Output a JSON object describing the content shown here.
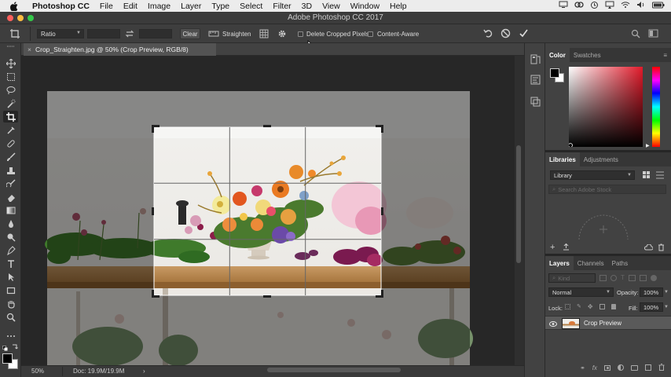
{
  "menubar": {
    "app_name": "Photoshop CC",
    "items": [
      "File",
      "Edit",
      "Image",
      "Layer",
      "Type",
      "Select",
      "Filter",
      "3D",
      "View",
      "Window",
      "Help"
    ]
  },
  "window": {
    "title": "Adobe Photoshop CC 2017"
  },
  "options_bar": {
    "ratio_label": "Ratio",
    "clear_label": "Clear",
    "straighten_label": "Straighten",
    "delete_cropped_label": "Delete Cropped Pixels",
    "delete_cropped_checked": false,
    "content_aware_label": "Content-Aware",
    "content_aware_checked": false
  },
  "document": {
    "tab_title": "Crop_Straighten.jpg @ 50% (Crop Preview, RGB/8)"
  },
  "status": {
    "zoom": "50%",
    "doc_info": "Doc: 19.9M/19.9M"
  },
  "color_panel": {
    "tabs": [
      "Color",
      "Swatches"
    ],
    "active_tab": "Color",
    "foreground": "#000000",
    "background": "#ffffff",
    "hue": "#e21a2a"
  },
  "libraries_panel": {
    "tabs": [
      "Libraries",
      "Adjustments"
    ],
    "active_tab": "Libraries",
    "library_select": "Library",
    "search_placeholder": "Search Adobe Stock"
  },
  "layers_panel": {
    "tabs": [
      "Layers",
      "Channels",
      "Paths"
    ],
    "active_tab": "Layers",
    "kind_placeholder": "Kind",
    "blend_mode": "Normal",
    "opacity_label": "Opacity:",
    "opacity_value": "100%",
    "lock_label": "Lock:",
    "fill_label": "Fill:",
    "fill_value": "100%",
    "layers": [
      {
        "name": "Crop Preview",
        "visible": true,
        "selected": true
      }
    ]
  },
  "tools": [
    "move",
    "marquee",
    "lasso",
    "quick-select",
    "crop",
    "eyedropper",
    "healing",
    "brush",
    "clone-stamp",
    "history-brush",
    "eraser",
    "gradient",
    "blur",
    "dodge",
    "pen",
    "type",
    "path-select",
    "rectangle",
    "hand",
    "zoom",
    "more"
  ],
  "active_tool": "crop"
}
